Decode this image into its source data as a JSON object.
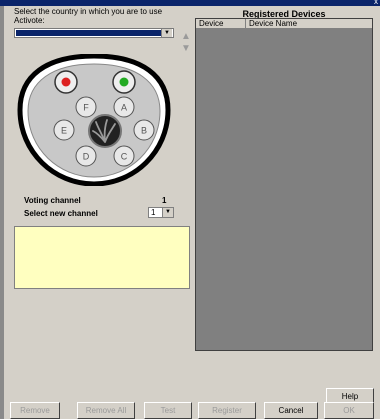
{
  "window": {
    "close_glyph": "x"
  },
  "instructions": {
    "line1": "Select the country in which you are to use",
    "line2": "Activote:"
  },
  "country_select": {
    "value": ""
  },
  "remote": {
    "keys": [
      "A",
      "B",
      "C",
      "D",
      "E",
      "F"
    ]
  },
  "devices": {
    "heading": "Registered Devices",
    "columns": [
      "Device",
      "Device Name"
    ],
    "rows": []
  },
  "channel": {
    "voting_label": "Voting channel",
    "voting_value": "1",
    "select_label": "Select new channel",
    "select_value": "1"
  },
  "buttons": {
    "help": "Help",
    "remove": "Remove",
    "remove_all": "Remove All",
    "test": "Test",
    "register": "Register",
    "cancel": "Cancel",
    "ok": "OK"
  }
}
